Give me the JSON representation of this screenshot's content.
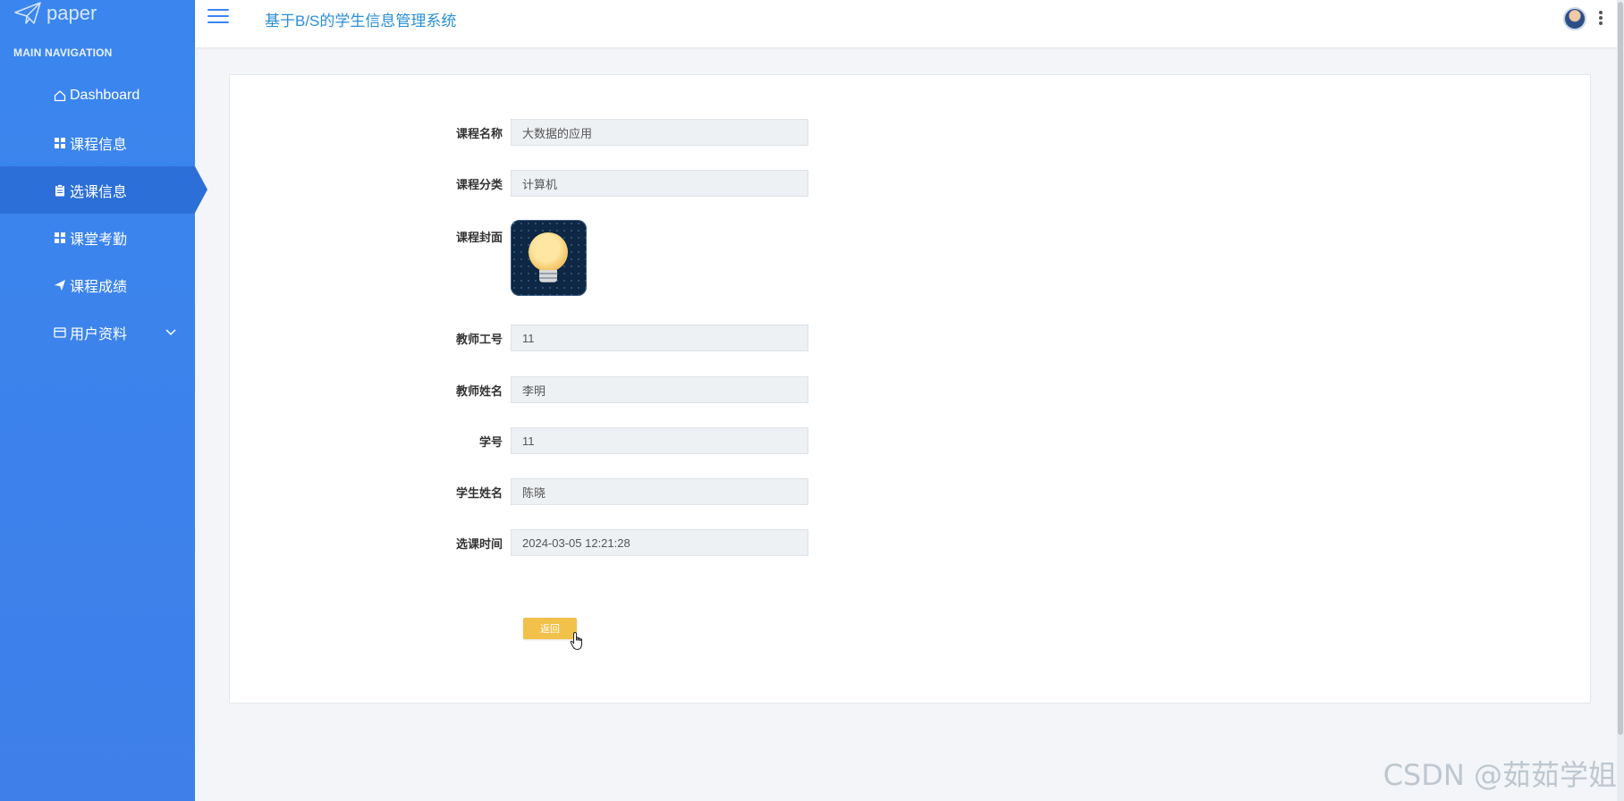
{
  "sidebar": {
    "logo_text": "paper",
    "nav_header": "MAIN NAVIGATION",
    "items": [
      {
        "label": "Dashboard",
        "icon": "home-icon"
      },
      {
        "label": "课程信息",
        "icon": "grid-icon"
      },
      {
        "label": "选课信息",
        "icon": "clipboard-icon",
        "active": true
      },
      {
        "label": "课堂考勤",
        "icon": "grid-icon"
      },
      {
        "label": "课程成绩",
        "icon": "send-icon"
      },
      {
        "label": "用户资料",
        "icon": "card-icon",
        "has_children": true
      }
    ]
  },
  "topbar": {
    "title": "基于B/S的学生信息管理系统"
  },
  "form": {
    "course_name": {
      "label": "课程名称",
      "value": "大数据的应用"
    },
    "course_category": {
      "label": "课程分类",
      "value": "计算机"
    },
    "course_cover": {
      "label": "课程封面"
    },
    "teacher_id": {
      "label": "教师工号",
      "value": "11"
    },
    "teacher_name": {
      "label": "教师姓名",
      "value": "李明"
    },
    "student_id": {
      "label": "学号",
      "value": "11"
    },
    "student_name": {
      "label": "学生姓名",
      "value": "陈晓"
    },
    "select_time": {
      "label": "选课时间",
      "value": "2024-03-05 12:21:28"
    },
    "back_label": "返回"
  },
  "watermark": "CSDN @茹茹学姐",
  "colors": {
    "sidebar": "#3a86ee",
    "active": "#2d6fd8",
    "title": "#2a8fd6",
    "button": "#f2c14a"
  }
}
